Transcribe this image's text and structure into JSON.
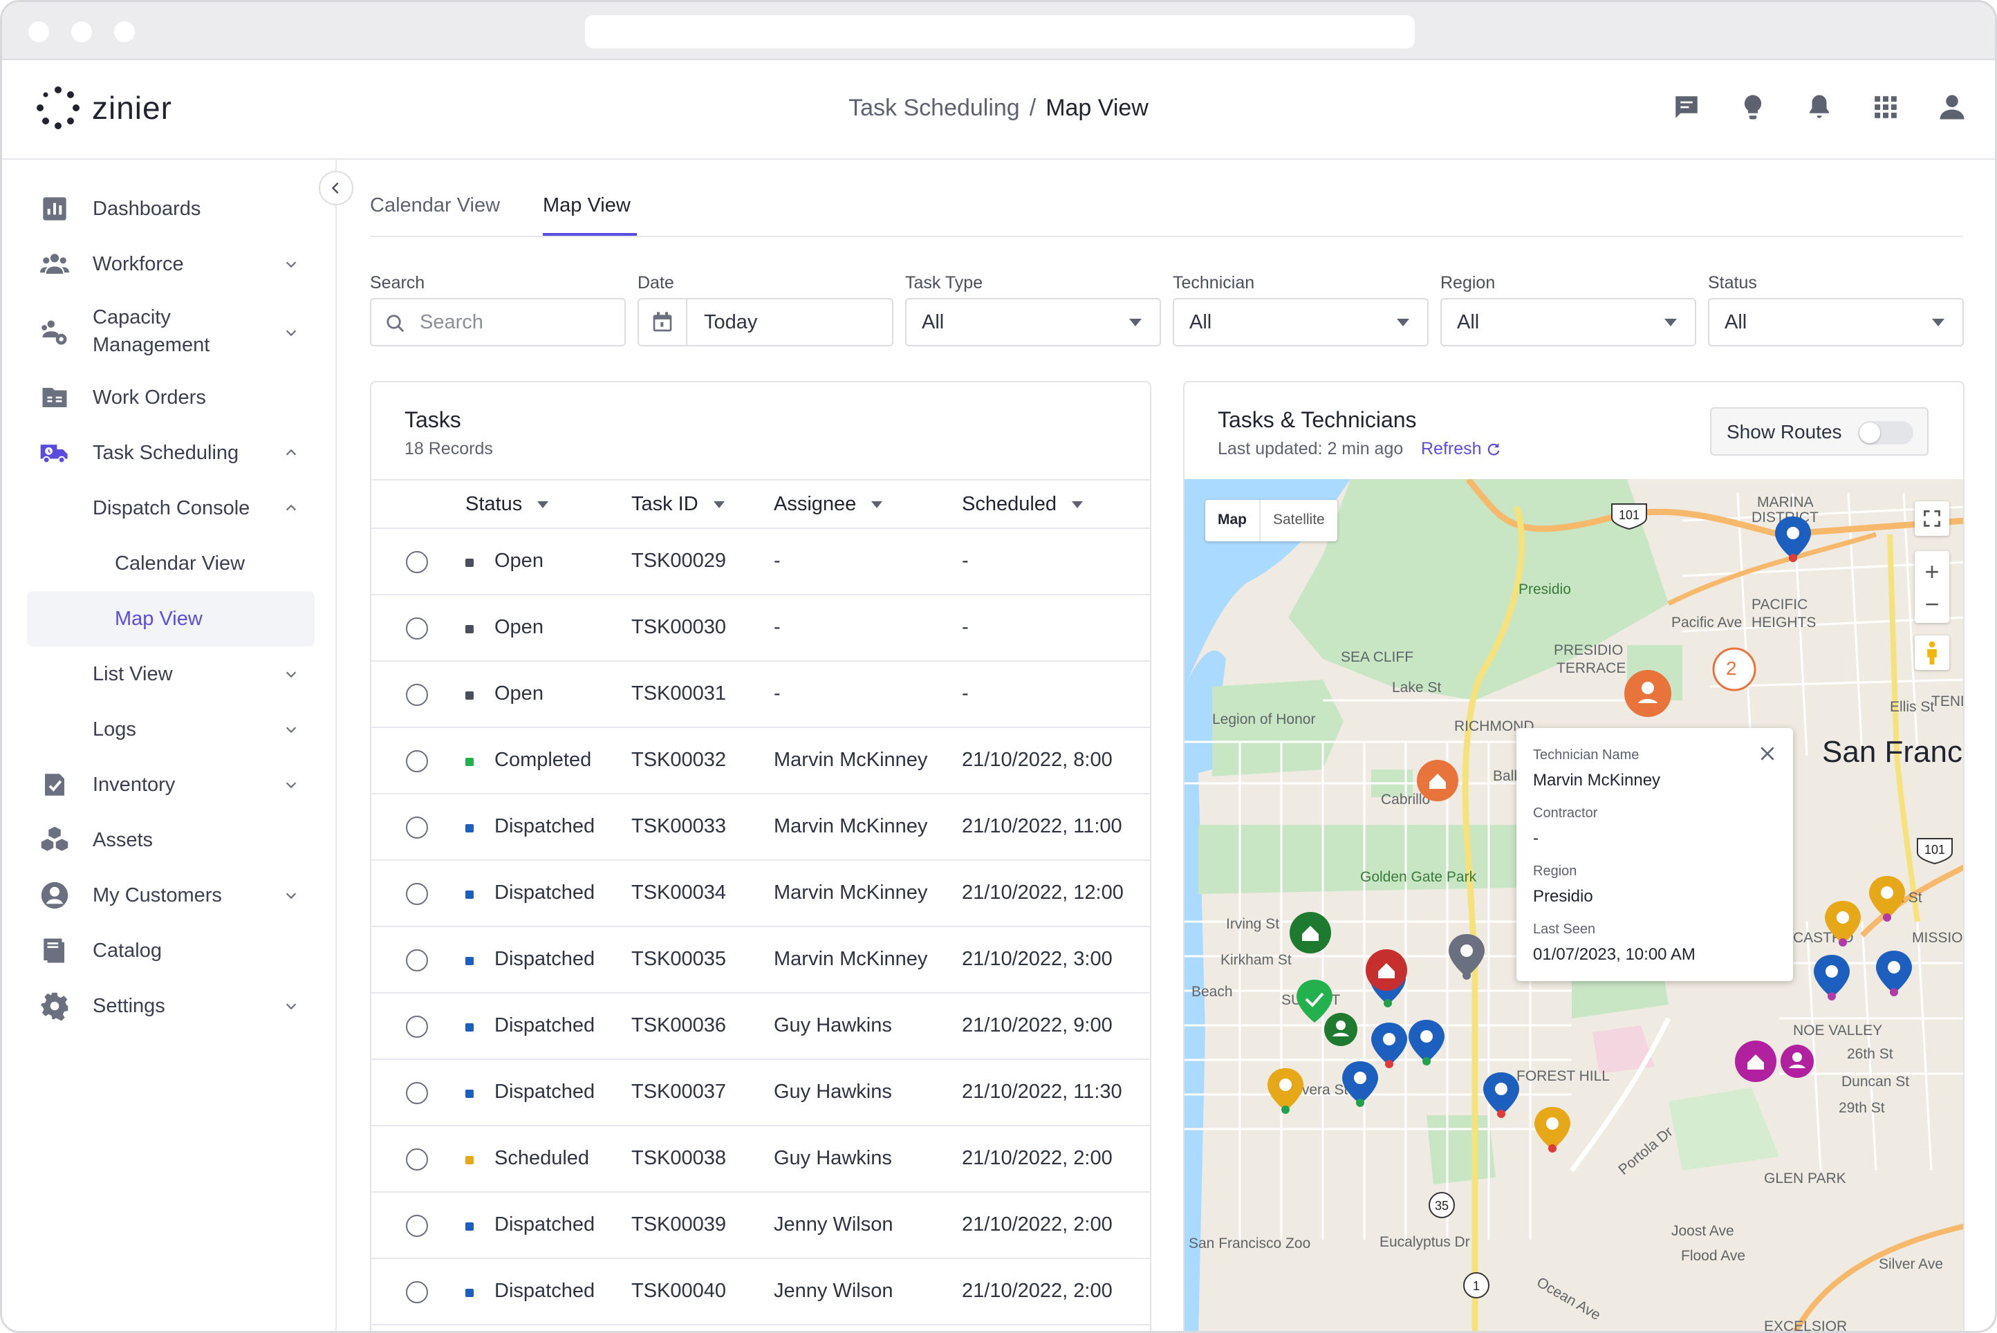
{
  "app": {
    "logo_text": "zinier"
  },
  "breadcrumb": {
    "parent": "Task Scheduling",
    "separator": "/",
    "current": "Map View"
  },
  "header_icons": [
    "chat-icon",
    "lightbulb-icon",
    "bell-icon",
    "apps-grid-icon",
    "user-icon"
  ],
  "sidebar": {
    "items": [
      {
        "label": "Dashboards",
        "icon": "bar-chart-icon"
      },
      {
        "label": "Workforce",
        "icon": "people-icon"
      },
      {
        "label": "Capacity Management",
        "icon": "people-settings-icon"
      },
      {
        "label": "Work Orders",
        "icon": "folder-icon"
      },
      {
        "label": "Task Scheduling",
        "icon": "truck-icon"
      },
      {
        "label": "Inventory",
        "icon": "clipboard-check-icon"
      },
      {
        "label": "Assets",
        "icon": "boxes-icon"
      },
      {
        "label": "My Customers",
        "icon": "customer-icon"
      },
      {
        "label": "Catalog",
        "icon": "book-icon"
      },
      {
        "label": "Settings",
        "icon": "gear-icon"
      }
    ],
    "capacity_line1": "Capacity",
    "capacity_line2": "Management",
    "sub": {
      "dispatch_console": "Dispatch Console",
      "calendar_view": "Calendar View",
      "map_view": "Map View",
      "list_view": "List View",
      "logs": "Logs"
    }
  },
  "tabs": [
    {
      "label": "Calendar View"
    },
    {
      "label": "Map View"
    }
  ],
  "filters": {
    "search": {
      "label": "Search",
      "placeholder": "Search"
    },
    "date": {
      "label": "Date",
      "value": "Today"
    },
    "task_type": {
      "label": "Task Type",
      "value": "All"
    },
    "technician": {
      "label": "Technician",
      "value": "All"
    },
    "region": {
      "label": "Region",
      "value": "All"
    },
    "status": {
      "label": "Status",
      "value": "All"
    }
  },
  "tasks": {
    "title": "Tasks",
    "records": "18 Records",
    "columns": {
      "status": "Status",
      "task_id": "Task ID",
      "assignee": "Assignee",
      "scheduled": "Scheduled"
    },
    "rows": [
      {
        "status": "Open",
        "color": "#4a4f5c",
        "id": "TSK00029",
        "assignee": "-",
        "scheduled": "-"
      },
      {
        "status": "Open",
        "color": "#4a4f5c",
        "id": "TSK00030",
        "assignee": "-",
        "scheduled": "-"
      },
      {
        "status": "Open",
        "color": "#4a4f5c",
        "id": "TSK00031",
        "assignee": "-",
        "scheduled": "-"
      },
      {
        "status": "Completed",
        "color": "#22b14c",
        "id": "TSK00032",
        "assignee": "Marvin McKinney",
        "scheduled": "21/10/2022, 8:00"
      },
      {
        "status": "Dispatched",
        "color": "#1d5fbf",
        "id": "TSK00033",
        "assignee": "Marvin McKinney",
        "scheduled": "21/10/2022, 11:00"
      },
      {
        "status": "Dispatched",
        "color": "#1d5fbf",
        "id": "TSK00034",
        "assignee": "Marvin McKinney",
        "scheduled": "21/10/2022, 12:00"
      },
      {
        "status": "Dispatched",
        "color": "#1d5fbf",
        "id": "TSK00035",
        "assignee": "Marvin McKinney",
        "scheduled": "21/10/2022, 3:00"
      },
      {
        "status": "Dispatched",
        "color": "#1d5fbf",
        "id": "TSK00036",
        "assignee": "Guy Hawkins",
        "scheduled": "21/10/2022, 9:00"
      },
      {
        "status": "Dispatched",
        "color": "#1d5fbf",
        "id": "TSK00037",
        "assignee": "Guy Hawkins",
        "scheduled": "21/10/2022, 11:30"
      },
      {
        "status": "Scheduled",
        "color": "#e6a817",
        "id": "TSK00038",
        "assignee": "Guy Hawkins",
        "scheduled": "21/10/2022, 2:00"
      },
      {
        "status": "Dispatched",
        "color": "#1d5fbf",
        "id": "TSK00039",
        "assignee": "Jenny Wilson",
        "scheduled": "21/10/2022, 2:00"
      },
      {
        "status": "Dispatched",
        "color": "#1d5fbf",
        "id": "TSK00040",
        "assignee": "Jenny Wilson",
        "scheduled": "21/10/2022, 2:00"
      }
    ]
  },
  "map": {
    "title": "Tasks & Technicians",
    "last_updated": "Last updated: 2 min ago",
    "refresh": "Refresh",
    "show_routes": "Show Routes",
    "map_btn": "Map",
    "satellite_btn": "Satellite",
    "cluster_count": "2",
    "tooltip": {
      "tech_label": "Technician Name",
      "tech_value": "Marvin McKinney",
      "contractor_label": "Contractor",
      "contractor_value": "-",
      "region_label": "Region",
      "region_value": "Presidio",
      "seen_label": "Last Seen",
      "seen_value": "01/07/2023, 10:00 AM"
    },
    "labels": {
      "presidio": "Presidio",
      "marina": "MARINA",
      "district": "DISTRICT",
      "pacific": "PACIFIC",
      "heights": "HEIGHTS",
      "sea_cliff": "SEA CLIFF",
      "presidio_terrace1": "PRESIDIO",
      "presidio_terrace2": "TERRACE",
      "lake_st": "Lake St",
      "legion": "Legion of Honor",
      "richmond": "RICHMOND",
      "golden_gate": "Golden Gate Park",
      "irving": "Irving St",
      "kirkham": "Kirkham St",
      "beach": "Beach",
      "sunset": "SUNSET",
      "rivera": "Rivera St",
      "forest_hill": "FOREST HILL",
      "portola": "Portola Dr",
      "noe": "NOE VALLEY",
      "mission": "MISSION",
      "castro": "CASTRO",
      "glen_park": "GLEN PARK",
      "zoo": "San Francisco Zoo",
      "eucalyptus": "Eucalyptus Dr",
      "ocean": "Ocean Ave",
      "city": "San Franc",
      "pacific_ave": "Pacific Ave",
      "fifteenth": "15th St",
      "duncan": "Duncan St",
      "twentysixth": "26th St",
      "twentyninth": "29th St",
      "joost": "Joost Ave",
      "flood": "Flood Ave",
      "silver": "Silver Ave",
      "excelsior": "EXCELSIOR",
      "ellis": "Ellis St",
      "tender": "TEND",
      "balb": "Balb",
      "cabrillo": "Cabrillo"
    }
  }
}
